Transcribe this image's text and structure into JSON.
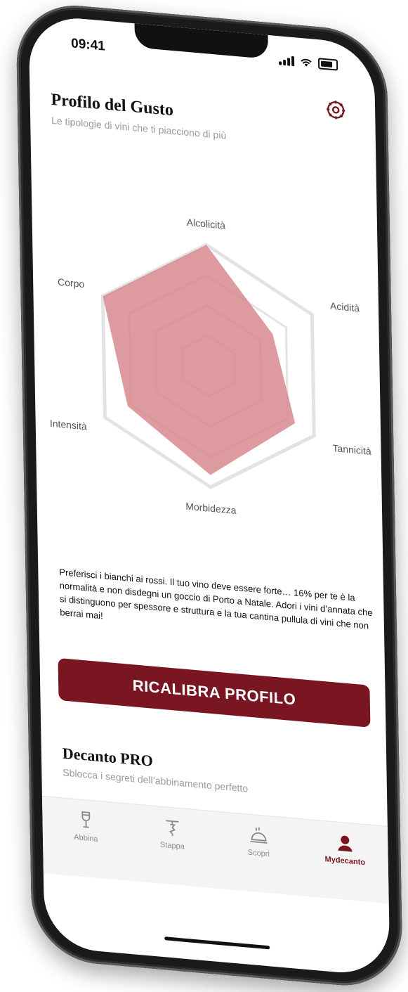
{
  "status": {
    "time": "09:41"
  },
  "header": {
    "title": "Profilo del Gusto",
    "subtitle": "Le tipologie di vini che ti piacciono di più"
  },
  "chart_data": {
    "type": "radar",
    "axes": [
      "Alcolicità",
      "Acidità",
      "Tannicità",
      "Morbidezza",
      "Intensità",
      "Corpo"
    ],
    "values": [
      1.0,
      0.62,
      0.82,
      0.9,
      0.78,
      1.0
    ],
    "range": [
      0,
      1
    ],
    "grid_levels": 4,
    "fill_color": "#d78a8f"
  },
  "profile": {
    "description": "Preferisci i bianchi ai rossi. Il tuo vino deve essere forte… 16% per te è la normalità e non disdegni un goccio di Porto a Natale. Adori i vini d’annata che si distinguono per spessore e struttura e la tua cantina pullula di vini che non berrai mai!",
    "recalibrate_label": "RICALIBRA PROFILO"
  },
  "pro": {
    "title": "Decanto PRO",
    "subtitle": "Sblocca i segreti dell’abbinamento perfetto"
  },
  "tabbar": {
    "items": [
      {
        "label": "Abbina",
        "icon": "wine-glass-icon"
      },
      {
        "label": "Stappa",
        "icon": "corkscrew-icon"
      },
      {
        "label": "Scopri",
        "icon": "cloche-icon"
      },
      {
        "label": "Mydecanto",
        "icon": "user-icon"
      }
    ],
    "active_index": 3
  },
  "colors": {
    "accent": "#7a1622",
    "radar_fill": "#d78a8f",
    "grid": "#e3e3e3"
  }
}
